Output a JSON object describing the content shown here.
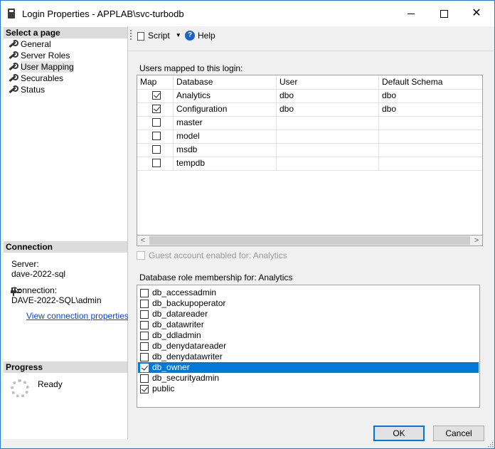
{
  "window": {
    "title": "Login Properties - APPLAB\\svc-turbodb"
  },
  "sidebar": {
    "select_page_header": "Select a page",
    "items": [
      {
        "label": "General",
        "icon": "wrench-icon"
      },
      {
        "label": "Server Roles",
        "icon": "wrench-icon"
      },
      {
        "label": "User Mapping",
        "icon": "wrench-icon",
        "selected": true
      },
      {
        "label": "Securables",
        "icon": "wrench-icon"
      },
      {
        "label": "Status",
        "icon": "wrench-icon"
      }
    ],
    "connection": {
      "header": "Connection",
      "server_label": "Server:",
      "server_value": "dave-2022-sql",
      "connection_label": "Connection:",
      "connection_value": "DAVE-2022-SQL\\admin",
      "view_link": "View connection properties"
    },
    "progress": {
      "header": "Progress",
      "status": "Ready"
    }
  },
  "toolbar": {
    "script_label": "Script",
    "help_label": "Help"
  },
  "mapping": {
    "label": "Users mapped to this login:",
    "columns": [
      "Map",
      "Database",
      "User",
      "Default Schema"
    ],
    "rows": [
      {
        "checked": true,
        "database": "Analytics",
        "user": "dbo",
        "schema": "dbo"
      },
      {
        "checked": true,
        "database": "Configuration",
        "user": "dbo",
        "schema": "dbo"
      },
      {
        "checked": false,
        "database": "master",
        "user": "",
        "schema": ""
      },
      {
        "checked": false,
        "database": "model",
        "user": "",
        "schema": ""
      },
      {
        "checked": false,
        "database": "msdb",
        "user": "",
        "schema": ""
      },
      {
        "checked": false,
        "database": "tempdb",
        "user": "",
        "schema": ""
      }
    ]
  },
  "guest": {
    "label": "Guest account enabled for: Analytics",
    "checked": false
  },
  "roles": {
    "label": "Database role membership for: Analytics",
    "items": [
      {
        "name": "db_accessadmin",
        "checked": false
      },
      {
        "name": "db_backupoperator",
        "checked": false
      },
      {
        "name": "db_datareader",
        "checked": false
      },
      {
        "name": "db_datawriter",
        "checked": false
      },
      {
        "name": "db_ddladmin",
        "checked": false
      },
      {
        "name": "db_denydatareader",
        "checked": false
      },
      {
        "name": "db_denydatawriter",
        "checked": false
      },
      {
        "name": "db_owner",
        "checked": true,
        "selected": true
      },
      {
        "name": "db_securityadmin",
        "checked": false
      },
      {
        "name": "public",
        "checked": true
      }
    ]
  },
  "buttons": {
    "ok": "OK",
    "cancel": "Cancel"
  },
  "colors": {
    "selection": "#0078d7",
    "link": "#0645d8",
    "window_border": "#2b78c6"
  }
}
